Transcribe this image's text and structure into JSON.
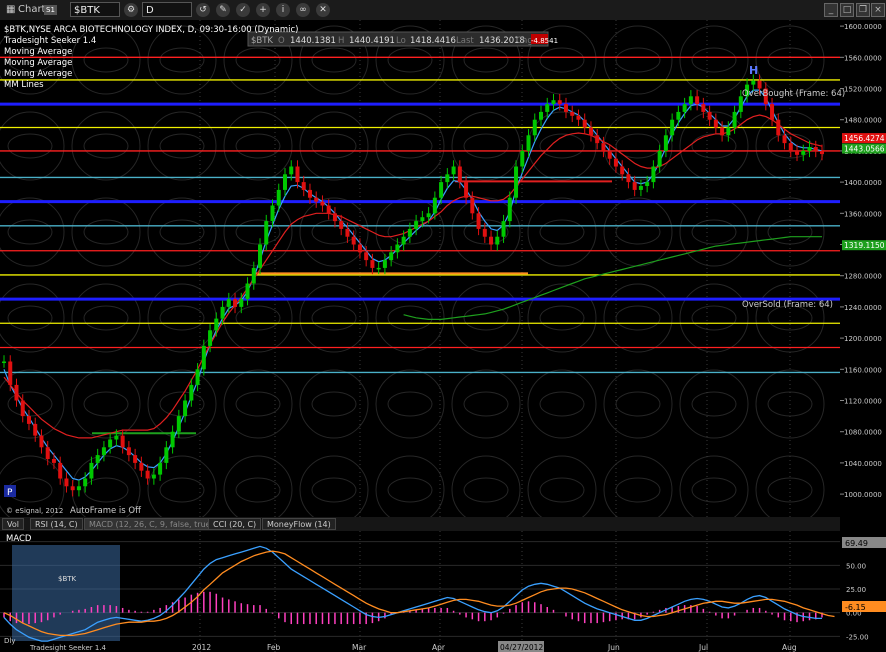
{
  "toolbar": {
    "title": "Chart",
    "title_badge": "S1",
    "symbol": "$BTK",
    "interval": "D"
  },
  "quote": {
    "symbol": "$BTK",
    "open_label": "O",
    "open": "1440.1381",
    "high_label": "H",
    "high": "1440.4191",
    "low_label": "Lo",
    "low": "1418.4416",
    "last_label": "Last",
    "last": "1436.2018",
    "chg_label": "Chg",
    "chg": "-4.8541"
  },
  "legend": {
    "study_title": "$BTK,NYSE ARCA BIOTECHNOLOGY INDEX, D, 09:30-16:00 (Dynamic)",
    "items": [
      "Tradesight Seeker 1.4",
      "Moving Average",
      "Moving Average",
      "Moving Average",
      "MM Lines"
    ]
  },
  "annotations": {
    "overbought": "OverBought (Frame: 64)",
    "oversold": "OverSold (Frame: 64)",
    "h_marker": "H",
    "copyright": "© eSignal, 2012",
    "autoframe": "AutoFrame is Off",
    "p_badge": "P"
  },
  "tabs": [
    "Vol",
    "RSI (14, C)",
    "MACD (12, 26, C, 9, false, true)",
    "CCI (20, C)",
    "MoneyFlow (14)"
  ],
  "lower_panel": {
    "title": "MACD",
    "value_upper": "69.49",
    "value_lower": "-6.15",
    "footer_text": "Tradesight Seeker 1.4",
    "data_window_symbol": "$BTK",
    "data_window_small": "Dly"
  },
  "colors": {
    "background": "#000000",
    "price_up": "#00c800",
    "price_down": "#e01010",
    "ma_fast": "#3aa0ff",
    "ma_mid": "#e02020",
    "ma_slow": "#1ea01e",
    "mm_blue": "#1e1eff",
    "mm_red": "#ff2020",
    "mm_yellow": "#f0f000",
    "mm_cyan": "#4ab0c8",
    "macd_line": "#3aa0ff",
    "signal_line": "#ff8c20",
    "histogram": "#ff40c0"
  },
  "chart_data": [
    {
      "type": "line",
      "title": "$BTK,NYSE ARCA BIOTECHNOLOGY INDEX, D, 09:30-16:00 (Dynamic)",
      "x_tick_labels": [
        "2012",
        "Feb",
        "Mar",
        "Apr",
        "04/27/2012",
        "Jun",
        "Jul",
        "Aug"
      ],
      "y_tick_labels": [
        "1000.0000",
        "1040.0000",
        "1080.0000",
        "1120.0000",
        "1160.0000",
        "1200.0000",
        "1240.0000",
        "1280.0000",
        "1320.0000",
        "1360.0000",
        "1400.0000",
        "1440.0000",
        "1480.0000",
        "1520.0000",
        "1560.0000",
        "1600.0000"
      ],
      "ylim": [
        995,
        1604
      ],
      "price_tags": [
        "1456.4274",
        "1443.0566",
        "1319.1150"
      ],
      "price_tag_values": [
        1456.43,
        1443.06,
        1319.12
      ],
      "mm_lines": [
        {
          "value": 1560,
          "color": "red"
        },
        {
          "value": 1531,
          "color": "yellow"
        },
        {
          "value": 1500,
          "color": "blue"
        },
        {
          "value": 1470,
          "color": "yellow"
        },
        {
          "value": 1440,
          "color": "red"
        },
        {
          "value": 1406,
          "color": "cyan"
        },
        {
          "value": 1375,
          "color": "blue"
        },
        {
          "value": 1344,
          "color": "cyan"
        },
        {
          "value": 1312,
          "color": "red"
        },
        {
          "value": 1281,
          "color": "yellow"
        },
        {
          "value": 1250,
          "color": "blue"
        },
        {
          "value": 1219,
          "color": "yellow"
        },
        {
          "value": 1188,
          "color": "red"
        },
        {
          "value": 1156,
          "color": "cyan"
        }
      ],
      "series": [
        {
          "name": "Price",
          "values": [
            1170,
            1140,
            1120,
            1100,
            1090,
            1075,
            1060,
            1045,
            1040,
            1020,
            1010,
            1005,
            1010,
            1020,
            1040,
            1050,
            1060,
            1070,
            1075,
            1060,
            1050,
            1040,
            1030,
            1020,
            1025,
            1040,
            1060,
            1080,
            1100,
            1120,
            1140,
            1160,
            1190,
            1210,
            1225,
            1240,
            1250,
            1240,
            1250,
            1270,
            1290,
            1320,
            1350,
            1370,
            1390,
            1410,
            1420,
            1400,
            1390,
            1380,
            1375,
            1370,
            1360,
            1350,
            1340,
            1330,
            1320,
            1310,
            1300,
            1290,
            1290,
            1300,
            1310,
            1320,
            1330,
            1340,
            1350,
            1355,
            1360,
            1380,
            1400,
            1410,
            1420,
            1400,
            1380,
            1360,
            1340,
            1330,
            1320,
            1330,
            1350,
            1380,
            1420,
            1440,
            1460,
            1480,
            1490,
            1500,
            1505,
            1500,
            1490,
            1485,
            1480,
            1470,
            1460,
            1450,
            1440,
            1430,
            1420,
            1410,
            1400,
            1390,
            1395,
            1400,
            1420,
            1440,
            1460,
            1480,
            1490,
            1500,
            1510,
            1500,
            1490,
            1480,
            1470,
            1460,
            1470,
            1490,
            1510,
            1525,
            1530,
            1520,
            1500,
            1480,
            1460,
            1450,
            1440,
            1435,
            1440,
            1445,
            1440,
            1436
          ]
        },
        {
          "name": "Moving Average",
          "values": [
            1160,
            1140,
            1125,
            1110,
            1098,
            1085,
            1072,
            1060,
            1050,
            1040,
            1030,
            1020,
            1018,
            1022,
            1030,
            1040,
            1050,
            1058,
            1062,
            1060,
            1055,
            1048,
            1040,
            1035,
            1034,
            1040,
            1052,
            1068,
            1086,
            1105,
            1125,
            1145,
            1170,
            1192,
            1210,
            1225,
            1238,
            1242,
            1248,
            1260,
            1278,
            1300,
            1325,
            1345,
            1365,
            1382,
            1395,
            1396,
            1392,
            1385,
            1380,
            1375,
            1368,
            1360,
            1350,
            1342,
            1332,
            1322,
            1312,
            1302,
            1298,
            1300,
            1306,
            1314,
            1322,
            1330,
            1338,
            1345,
            1350,
            1362,
            1378,
            1392,
            1402,
            1400,
            1390,
            1378,
            1362,
            1350,
            1340,
            1338,
            1345,
            1362,
            1390,
            1412,
            1432,
            1452,
            1468,
            1482,
            1492,
            1496,
            1494,
            1490,
            1486,
            1478,
            1470,
            1460,
            1450,
            1440,
            1430,
            1420,
            1410,
            1400,
            1398,
            1400,
            1410,
            1426,
            1444,
            1462,
            1476,
            1488,
            1498,
            1500,
            1496,
            1488,
            1480,
            1472,
            1472,
            1482,
            1496,
            1510,
            1518,
            1518,
            1508,
            1492,
            1476,
            1462,
            1452,
            1446,
            1444,
            1444,
            1442,
            1440
          ]
        },
        {
          "name": "Moving Average",
          "values": [
            1150,
            1140,
            1130,
            1120,
            1112,
            1104,
            1096,
            1090,
            1084,
            1080,
            1076,
            1074,
            1072,
            1072,
            1072,
            1074,
            1076,
            1078,
            1080,
            1082,
            1082,
            1082,
            1082,
            1082,
            1084,
            1090,
            1098,
            1108,
            1120,
            1132,
            1146,
            1160,
            1176,
            1192,
            1206,
            1220,
            1232,
            1242,
            1252,
            1264,
            1276,
            1288,
            1300,
            1312,
            1324,
            1336,
            1346,
            1352,
            1356,
            1358,
            1360,
            1360,
            1360,
            1358,
            1356,
            1352,
            1348,
            1344,
            1340,
            1336,
            1332,
            1330,
            1330,
            1332,
            1334,
            1338,
            1342,
            1346,
            1350,
            1356,
            1362,
            1370,
            1376,
            1380,
            1382,
            1382,
            1380,
            1378,
            1376,
            1376,
            1378,
            1384,
            1394,
            1404,
            1414,
            1424,
            1434,
            1442,
            1450,
            1456,
            1460,
            1462,
            1463,
            1462,
            1460,
            1456,
            1452,
            1448,
            1442,
            1436,
            1430,
            1424,
            1420,
            1418,
            1418,
            1420,
            1424,
            1430,
            1436,
            1442,
            1448,
            1454,
            1458,
            1460,
            1462,
            1462,
            1464,
            1468,
            1474,
            1480,
            1484,
            1486,
            1484,
            1480,
            1474,
            1468,
            1462,
            1458,
            1454,
            1450,
            1448,
            1446
          ]
        },
        {
          "name": "Moving Average",
          "values": [
            null,
            null,
            null,
            null,
            null,
            null,
            null,
            null,
            null,
            null,
            null,
            null,
            null,
            null,
            null,
            null,
            null,
            null,
            null,
            null,
            null,
            null,
            null,
            null,
            null,
            null,
            null,
            null,
            null,
            null,
            null,
            null,
            null,
            null,
            null,
            null,
            null,
            null,
            null,
            null,
            null,
            null,
            null,
            null,
            null,
            null,
            null,
            null,
            null,
            null,
            null,
            null,
            null,
            null,
            null,
            null,
            null,
            null,
            null,
            null,
            null,
            null,
            null,
            null,
            1230,
            1228,
            1226,
            1225,
            1224,
            1224,
            1224,
            1225,
            1226,
            1227,
            1228,
            1229,
            1230,
            1231,
            1233,
            1235,
            1237,
            1240,
            1243,
            1246,
            1249,
            1252,
            1255,
            1258,
            1261,
            1264,
            1267,
            1270,
            1273,
            1276,
            1278,
            1280,
            1282,
            1284,
            1286,
            1288,
            1290,
            1292,
            1294,
            1296,
            1298,
            1300,
            1302,
            1304,
            1306,
            1308,
            1310,
            1312,
            1314,
            1316,
            1318,
            1319,
            1320,
            1321,
            1322,
            1323,
            1324,
            1325,
            1326,
            1327,
            1328,
            1329,
            1330,
            1330,
            1330,
            1330,
            1330,
            1330
          ]
        }
      ]
    },
    {
      "type": "line",
      "title": "MACD",
      "y_tick_labels": [
        "75.00",
        "50.00",
        "25.00",
        "0.00",
        "-25.00"
      ],
      "ylim": [
        -32,
        82
      ],
      "series": [
        {
          "name": "MACD",
          "values": [
            -5,
            -12,
            -18,
            -22,
            -26,
            -28,
            -30,
            -30,
            -28,
            -26,
            -24,
            -22,
            -20,
            -18,
            -14,
            -10,
            -8,
            -6,
            -5,
            -6,
            -7,
            -8,
            -9,
            -8,
            -6,
            -3,
            2,
            8,
            15,
            22,
            30,
            38,
            46,
            52,
            56,
            58,
            60,
            62,
            64,
            66,
            68,
            70,
            68,
            64,
            58,
            52,
            46,
            42,
            38,
            34,
            30,
            26,
            22,
            18,
            14,
            10,
            6,
            2,
            -2,
            -4,
            -5,
            -4,
            -2,
            0,
            2,
            4,
            6,
            8,
            10,
            12,
            14,
            16,
            15,
            12,
            9,
            6,
            3,
            1,
            0,
            2,
            6,
            12,
            18,
            24,
            28,
            30,
            31,
            30,
            28,
            26,
            22,
            18,
            14,
            10,
            7,
            4,
            2,
            0,
            -2,
            -4,
            -6,
            -8,
            -8,
            -6,
            -3,
            0,
            3,
            6,
            9,
            12,
            14,
            15,
            14,
            12,
            9,
            6,
            5,
            7,
            10,
            14,
            17,
            18,
            16,
            12,
            8,
            4,
            1,
            -2,
            -4,
            -5,
            -6,
            -6
          ]
        },
        {
          "name": "Signal",
          "values": [
            0,
            -3,
            -7,
            -11,
            -14,
            -17,
            -20,
            -22,
            -23,
            -24,
            -24,
            -24,
            -23,
            -22,
            -20,
            -18,
            -16,
            -14,
            -12,
            -11,
            -10,
            -10,
            -10,
            -9,
            -9,
            -8,
            -6,
            -3,
            1,
            6,
            11,
            17,
            24,
            30,
            36,
            42,
            46,
            50,
            54,
            57,
            60,
            62,
            64,
            65,
            64,
            62,
            58,
            54,
            50,
            46,
            42,
            38,
            34,
            30,
            26,
            22,
            18,
            14,
            10,
            7,
            4,
            2,
            0,
            0,
            1,
            2,
            3,
            4,
            5,
            7,
            9,
            11,
            13,
            14,
            14,
            13,
            12,
            10,
            8,
            7,
            7,
            8,
            10,
            13,
            16,
            19,
            22,
            24,
            25,
            26,
            26,
            25,
            23,
            21,
            18,
            15,
            12,
            9,
            6,
            3,
            1,
            -1,
            -3,
            -4,
            -4,
            -3,
            -2,
            0,
            2,
            4,
            6,
            8,
            10,
            11,
            12,
            12,
            11,
            10,
            10,
            11,
            12,
            13,
            14,
            14,
            13,
            12,
            10,
            8,
            5,
            3,
            1,
            -1,
            -3,
            -4
          ]
        }
      ]
    }
  ]
}
